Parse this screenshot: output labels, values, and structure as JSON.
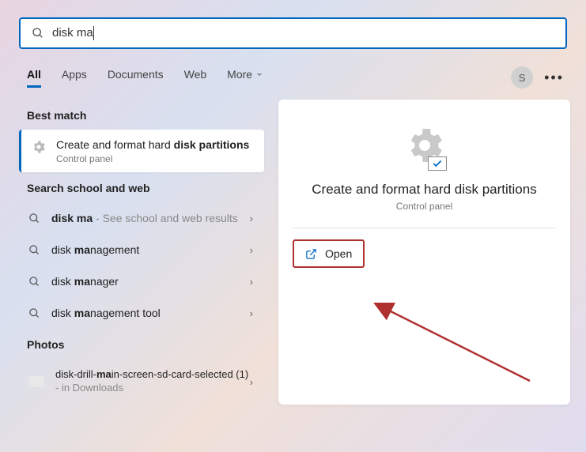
{
  "search": {
    "query": "disk ma"
  },
  "tabs": {
    "all": "All",
    "apps": "Apps",
    "documents": "Documents",
    "web": "Web",
    "more": "More"
  },
  "avatar_letter": "S",
  "bestmatch": {
    "heading": "Best match",
    "title_pre": "Create and format hard ",
    "title_bold1": "disk",
    "title_mid": " ",
    "title_bold2": "partitions",
    "sub": "Control panel"
  },
  "schoolweb": {
    "heading": "Search school and web",
    "rows": [
      {
        "pre": "",
        "bold": "disk ma",
        "post": "",
        "hint": " - See school and web results"
      },
      {
        "pre": "disk ",
        "bold": "ma",
        "post": "nagement",
        "hint": ""
      },
      {
        "pre": "disk ",
        "bold": "ma",
        "post": "nager",
        "hint": ""
      },
      {
        "pre": "disk ",
        "bold": "ma",
        "post": "nagement tool",
        "hint": ""
      }
    ]
  },
  "photos": {
    "heading": "Photos",
    "row": {
      "pre": "disk-drill-",
      "bold": "ma",
      "post": "in-screen-sd-card-selected (1)",
      "hint": " - in Downloads"
    }
  },
  "detail": {
    "title": "Create and format hard disk partitions",
    "sub": "Control panel",
    "open": "Open"
  }
}
